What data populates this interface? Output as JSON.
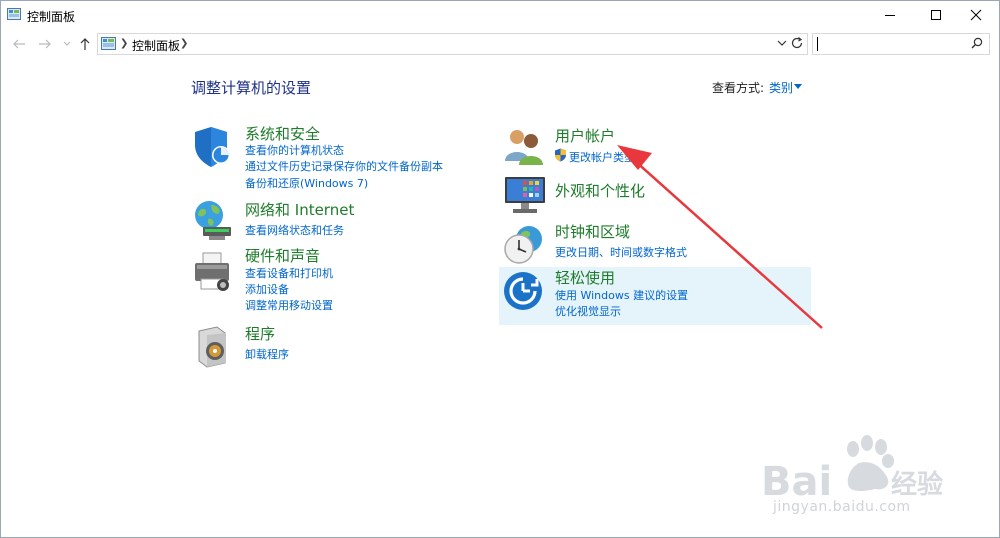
{
  "window": {
    "title": "控制面板"
  },
  "address": {
    "crumb": "控制面板",
    "search_placeholder": ""
  },
  "main": {
    "title": "调整计算机的设置",
    "view_by_label": "查看方式:",
    "view_by_value": "类别"
  },
  "categories": {
    "system": {
      "title": "系统和安全",
      "links": [
        "查看你的计算机状态",
        "通过文件历史记录保存你的文件备份副本",
        "备份和还原(Windows 7)"
      ]
    },
    "network": {
      "title": "网络和 Internet",
      "links": [
        "查看网络状态和任务"
      ]
    },
    "hardware": {
      "title": "硬件和声音",
      "links": [
        "查看设备和打印机",
        "添加设备",
        "调整常用移动设置"
      ]
    },
    "programs": {
      "title": "程序",
      "links": [
        "卸载程序"
      ]
    },
    "users": {
      "title": "用户帐户",
      "links": [
        "更改帐户类型"
      ]
    },
    "appearance": {
      "title": "外观和个性化",
      "links": []
    },
    "clock": {
      "title": "时钟和区域",
      "links": [
        "更改日期、时间或数字格式"
      ]
    },
    "ease": {
      "title": "轻松使用",
      "links": [
        "使用 Windows 建议的设置",
        "优化视觉显示"
      ]
    }
  },
  "watermark": {
    "text": "jingyan.baidu.com"
  },
  "colors": {
    "category_title": "#1e7c2a",
    "link": "#0066cc",
    "heading": "#1e3287",
    "highlight": "#e5f3fb",
    "annotation_arrow": "#e8383d"
  },
  "icons": {
    "system": "shield-icon",
    "network": "globe-network-icon",
    "hardware": "printer-icon",
    "programs": "program-box-icon",
    "users": "users-icon",
    "appearance": "monitor-colors-icon",
    "clock": "clock-globe-icon",
    "ease": "ease-of-access-icon"
  }
}
